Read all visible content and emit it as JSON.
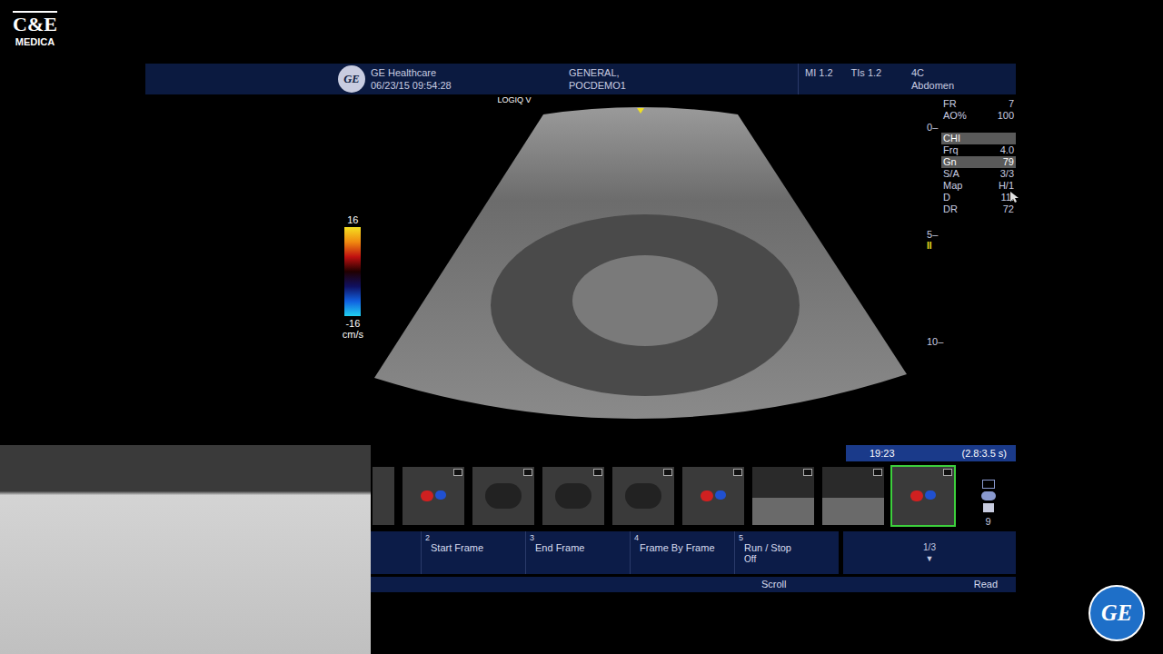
{
  "logo": {
    "brand": "C&E",
    "name": "MEDICA"
  },
  "header": {
    "brand_mark": "GE",
    "brand": "GE Healthcare",
    "datetime": "06/23/15 09:54:28",
    "exam": "GENERAL,",
    "patient": "POCDEMO1",
    "mi": "MI 1.2",
    "tis": "TIs 1.2",
    "probe": "4C",
    "preset": "Abdomen"
  },
  "image": {
    "system_label": "LOGIQ V"
  },
  "color_scale": {
    "max": "16",
    "min": "-16",
    "unit": "cm/s"
  },
  "depth_scale": [
    {
      "label": "0",
      "focus": false
    },
    {
      "label": "5",
      "focus": true
    },
    {
      "label": "10",
      "focus": false
    }
  ],
  "focus_marker": "II",
  "parameter_groups": [
    [
      {
        "label": "FR",
        "value": "7",
        "highlighted": false
      },
      {
        "label": "AO%",
        "value": "100",
        "highlighted": false
      }
    ],
    [
      {
        "label": "CHI",
        "highlighted": true
      },
      {
        "label": "Frq",
        "value": "4.0",
        "highlighted": false
      },
      {
        "label": "Gn",
        "value": "79",
        "highlighted": true
      },
      {
        "label": "S/A",
        "value": "3/3",
        "highlighted": false
      },
      {
        "label": "Map",
        "value": "H/1",
        "highlighted": false
      },
      {
        "label": "D",
        "value": "11.",
        "highlighted": false
      },
      {
        "label": "DR",
        "value": "72",
        "highlighted": false
      }
    ]
  ],
  "cine": {
    "time": "19:23",
    "range": "(2.8:3.5 s)"
  },
  "thumbnails": [
    {
      "kind": "partial",
      "selected": false
    },
    {
      "kind": "color",
      "selected": false
    },
    {
      "kind": "gray",
      "selected": false
    },
    {
      "kind": "gray",
      "selected": false
    },
    {
      "kind": "gray",
      "selected": false
    },
    {
      "kind": "color",
      "selected": false
    },
    {
      "kind": "mmode",
      "selected": false
    },
    {
      "kind": "mmode",
      "selected": false
    },
    {
      "kind": "color",
      "selected": true
    }
  ],
  "thumbnail_count": "9",
  "soft_keys": [
    {
      "number": "2",
      "label": "Start Frame"
    },
    {
      "number": "3",
      "label": "End Frame"
    },
    {
      "number": "4",
      "label": "Frame By Frame"
    },
    {
      "number": "5",
      "label": "Run / Stop",
      "sub": "Off"
    }
  ],
  "page": {
    "label": "1/3",
    "arrow": "▼"
  },
  "bottom_bar": [
    "Scroll",
    "Read"
  ],
  "corner_logo": "GE"
}
